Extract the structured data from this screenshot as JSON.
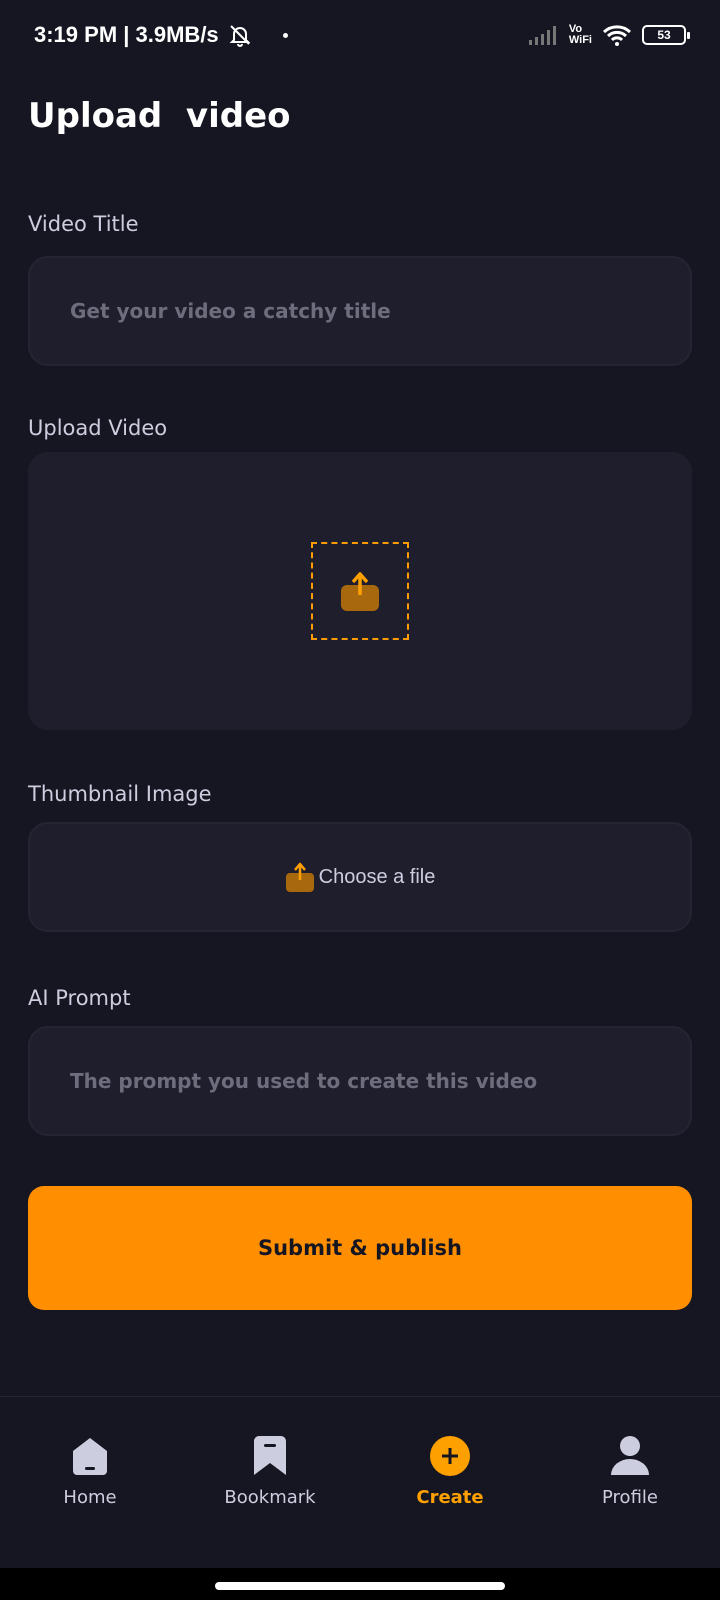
{
  "status_bar": {
    "time_speed": "3:19 PM | 3.9MB/s",
    "vo": "Vo",
    "wifi": "WiFi",
    "battery": "53"
  },
  "page_title": "Upload  video",
  "video_title": {
    "label": "Video Title",
    "placeholder": "Get your video a catchy title"
  },
  "upload_video": {
    "label": "Upload Video"
  },
  "thumbnail": {
    "label": "Thumbnail Image",
    "choose_text": "Choose a file"
  },
  "ai_prompt": {
    "label": "AI Prompt",
    "placeholder": "The prompt you used to create this video"
  },
  "submit": {
    "label": "Submit & publish"
  },
  "tabs": [
    {
      "label": "Home",
      "icon": "home-icon",
      "active": false
    },
    {
      "label": "Bookmark",
      "icon": "bookmark-icon",
      "active": false
    },
    {
      "label": "Create",
      "icon": "plus-icon",
      "active": true
    },
    {
      "label": "Profile",
      "icon": "profile-icon",
      "active": false
    }
  ],
  "colors": {
    "background": "#161622",
    "field": "#1E1E2D",
    "accent": "#FF8E01",
    "active_tab": "#FFA001"
  }
}
